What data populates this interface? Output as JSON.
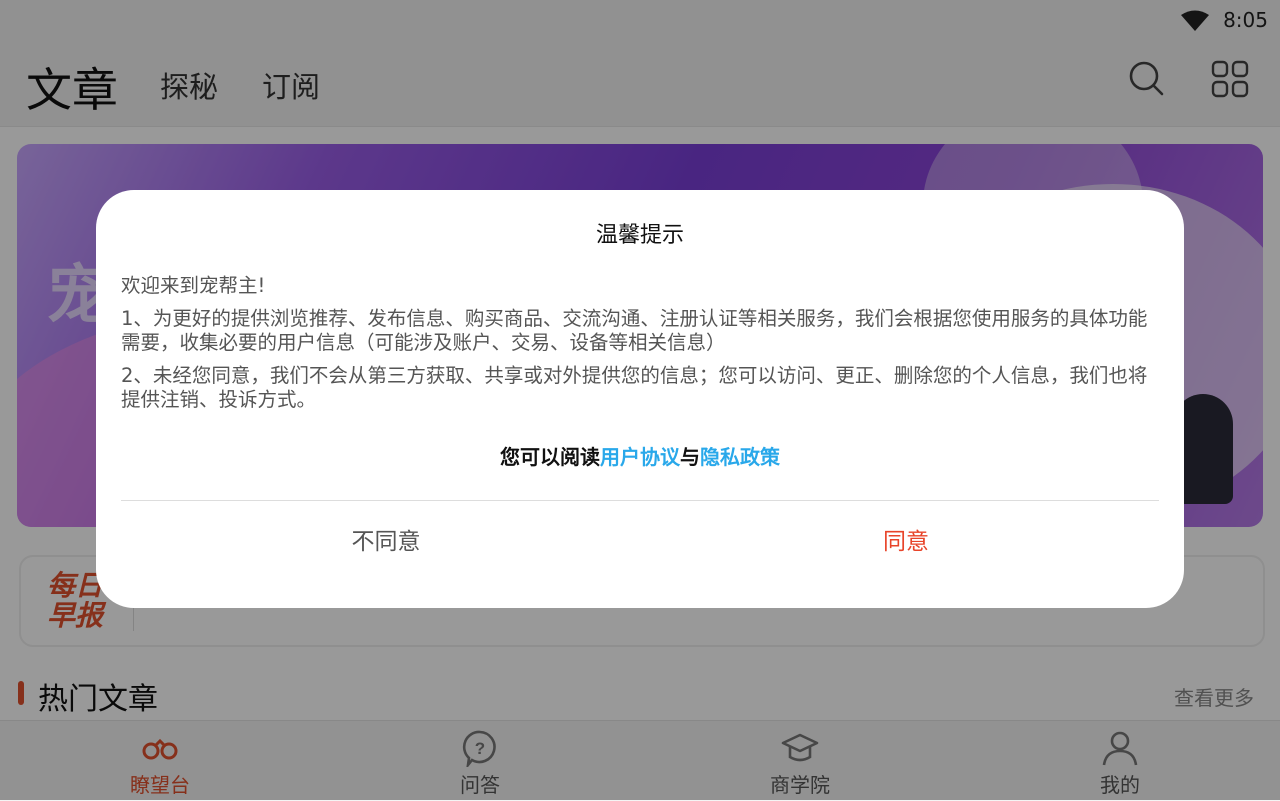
{
  "status_bar": {
    "time": "8:05",
    "wifi_icon": "wifi-icon"
  },
  "header": {
    "title": "文章",
    "tabs": [
      "探秘",
      "订阅"
    ],
    "search_icon": "search-icon",
    "grid_icon": "grid-menu-icon"
  },
  "banner": {
    "text": "宠"
  },
  "daily": {
    "logo_line1": "每日",
    "logo_line2": "早报"
  },
  "section": {
    "title": "热门文章",
    "more": "查看更多"
  },
  "bottom_nav": [
    {
      "label": "瞭望台",
      "icon": "binoculars-icon",
      "active": true
    },
    {
      "label": "问答",
      "icon": "question-bubble-icon",
      "active": false
    },
    {
      "label": "商学院",
      "icon": "graduation-cap-icon",
      "active": false
    },
    {
      "label": "我的",
      "icon": "user-icon",
      "active": false
    }
  ],
  "dialog": {
    "title": "温馨提示",
    "greeting": "欢迎来到宠帮主!",
    "para1": "1、为更好的提供浏览推荐、发布信息、购买商品、交流沟通、注册认证等相关服务，我们会根据您使用服务的具体功能需要，收集必要的用户信息（可能涉及账户、交易、设备等相关信息）",
    "para2": "2、未经您同意，我们不会从第三方获取、共享或对外提供您的信息；您可以访问、更正、删除您的个人信息，我们也将提供注销、投诉方式。",
    "links_prefix": "您可以阅读",
    "link_user_agreement": "用户协议",
    "links_and": "与",
    "link_privacy_policy": "隐私政策",
    "disagree_label": "不同意",
    "agree_label": "同意"
  },
  "colors": {
    "accent": "#e0502e",
    "agree": "#e8442a",
    "link": "#29a8ea",
    "overlay": "rgba(0,0,0,0.40)"
  }
}
